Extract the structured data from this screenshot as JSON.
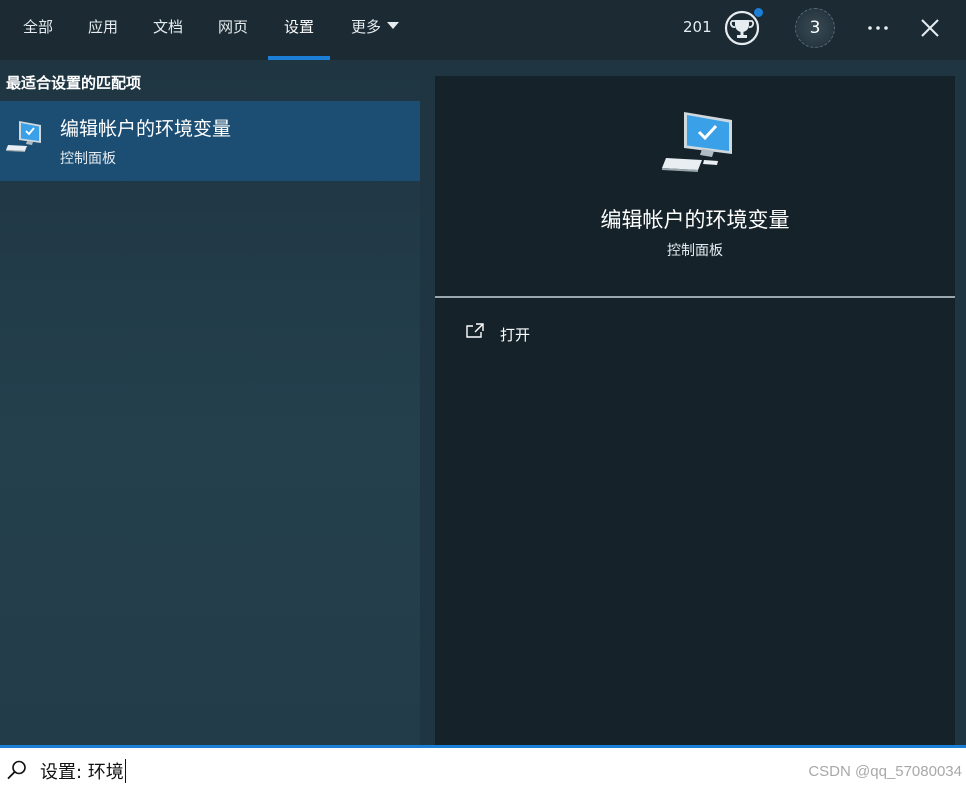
{
  "tabs": [
    {
      "label": "全部",
      "active": false
    },
    {
      "label": "应用",
      "active": false
    },
    {
      "label": "文档",
      "active": false
    },
    {
      "label": "网页",
      "active": false
    },
    {
      "label": "设置",
      "active": true
    },
    {
      "label": "更多",
      "active": false,
      "has_dropdown": true
    }
  ],
  "header": {
    "points": "201",
    "avatar_label": "3",
    "icons": [
      "trophy-icon",
      "more-icon",
      "close-icon"
    ],
    "accent_color": "#1b7fd8"
  },
  "results": {
    "section_title": "最适合设置的匹配项",
    "items": [
      {
        "title": "编辑帐户的环境变量",
        "subtitle": "控制面板",
        "icon": "computer-settings-icon",
        "selected": true
      }
    ]
  },
  "preview": {
    "title": "编辑帐户的环境变量",
    "subtitle": "控制面板",
    "actions": [
      {
        "label": "打开",
        "icon": "open-external-icon"
      }
    ]
  },
  "search": {
    "value": "设置: 环境",
    "icon": "search-icon"
  },
  "watermark": "CSDN @qq_57080034"
}
